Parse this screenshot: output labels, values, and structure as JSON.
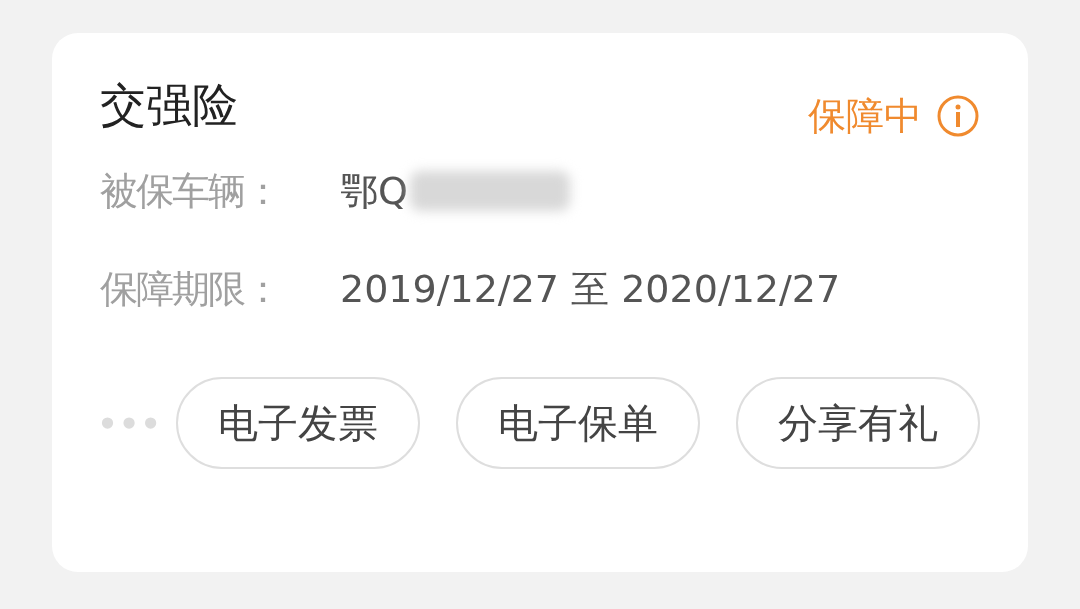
{
  "card": {
    "title": "交强险",
    "status": "保障中",
    "fields": [
      {
        "label": "被保车辆：",
        "value": "鄂Q",
        "redacted": true
      },
      {
        "label": "保障期限：",
        "value": "2019/12/27 至 2020/12/27",
        "redacted": false
      }
    ],
    "buttons": [
      "电子发票",
      "电子保单",
      "分享有礼"
    ]
  }
}
